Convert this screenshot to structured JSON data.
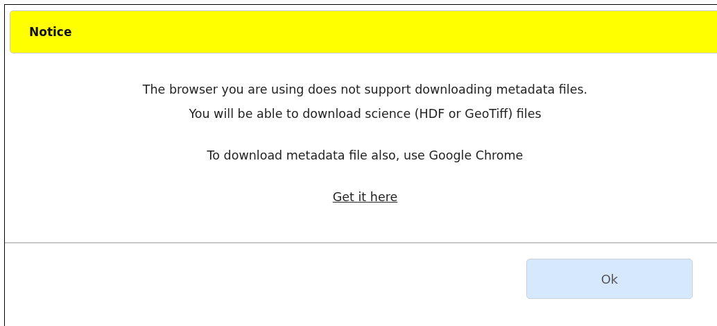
{
  "dialog": {
    "title": "Notice",
    "paragraphs": [
      [
        "The browser you are using does not support downloading metadata files.",
        "You will be able to download science (HDF or GeoTiff) files"
      ],
      [
        "To download metadata file also, use Google Chrome"
      ]
    ],
    "link": "Get it here",
    "buttons": [
      "Ok"
    ]
  }
}
